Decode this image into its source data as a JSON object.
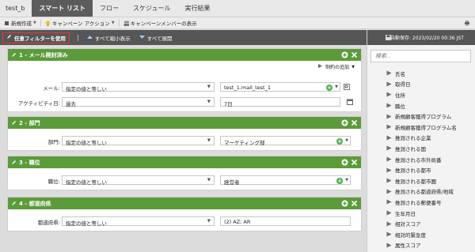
{
  "tabs": [
    "test_b",
    "スマート リスト",
    "フロー",
    "スケジュール",
    "実行結果"
  ],
  "toolbar": {
    "new_label": "新規作成",
    "campaign_action_label": "キャンペーン アクション",
    "show_members_label": "キャンペーンメンバーの表示"
  },
  "filter_toolbar": {
    "advanced_filter_label": "任意フィルターを使用",
    "collapse_all_label": "すべて縮小表示",
    "expand_all_label": "すべて展開"
  },
  "autosave": "自動保存: 2023/02/20 00:36 JST",
  "search": {
    "placeholder": "検索..."
  },
  "fields": [
    "氏名",
    "取得日",
    "住所",
    "職位",
    "新規顧客獲得プログラム",
    "新規顧客獲得プログラム名",
    "推測される企業",
    "推測される国",
    "推測される市外局番",
    "推測される都市",
    "推測される都市圏",
    "推測される都道府県/地域",
    "推測される郵便番号",
    "生年月日",
    "相対スコア",
    "相対的緊急度",
    "属性スコア"
  ],
  "filters": [
    {
      "title": "1 - メール開封済み",
      "constraint_label": "制約の追加",
      "rows": [
        {
          "label": "メール:",
          "operator": "指定の値と等しい",
          "value": "test_1.mail_test_1"
        },
        {
          "label": "アクティビティ日:",
          "operator": "過去",
          "value": "7日"
        }
      ]
    },
    {
      "title": "2 - 部門",
      "rows": [
        {
          "label": "部門:",
          "operator": "指定の値と等しい",
          "value": "マーケティング部"
        }
      ]
    },
    {
      "title": "3 - 職位",
      "rows": [
        {
          "label": "職位:",
          "operator": "指定の値と等しい",
          "value": "経営者"
        }
      ]
    },
    {
      "title": "4 - 都道府県",
      "rows": [
        {
          "label": "都道府県:",
          "operator": "指定の値と等しい",
          "value": "(2) AZ; AR"
        }
      ]
    }
  ],
  "colors": {
    "header_green": "#5b9b3a",
    "toolbar_dark": "#565656",
    "highlight_red": "#e53935",
    "plus_green": "#4caf50"
  }
}
